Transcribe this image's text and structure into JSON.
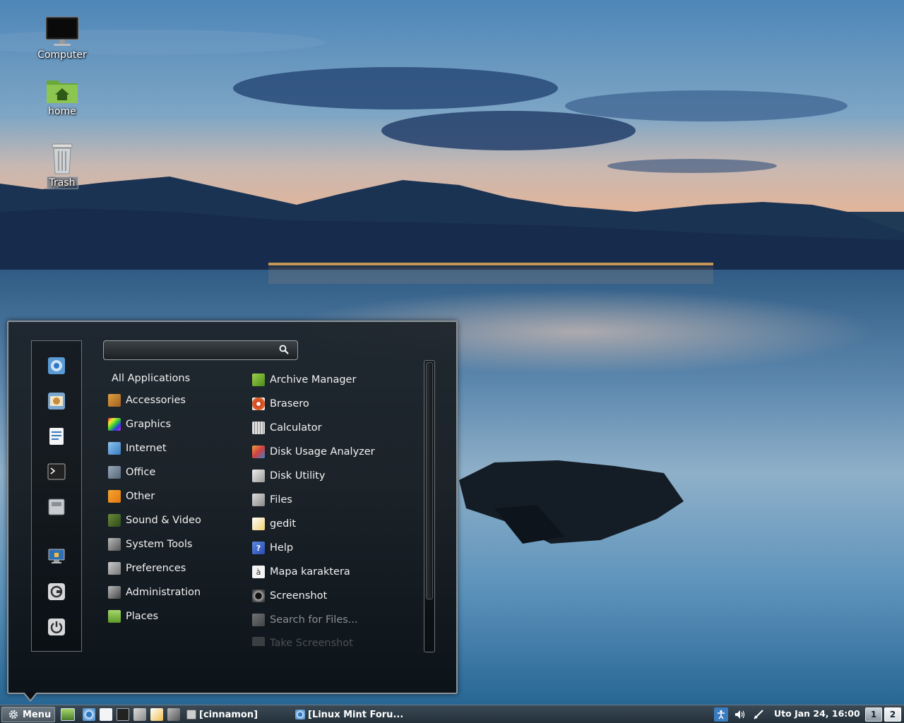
{
  "desktop": {
    "icons": [
      {
        "label": "Computer",
        "icon": "monitor-icon"
      },
      {
        "label": "home",
        "icon": "home-folder-icon"
      },
      {
        "label": "Trash",
        "icon": "trash-icon"
      }
    ]
  },
  "menu": {
    "search_value": "",
    "favorites": [
      "chromium-icon",
      "mail-client-icon",
      "text-editor-icon",
      "terminal-icon",
      "files-icon",
      "lock-screen-icon",
      "logout-icon",
      "shutdown-icon"
    ],
    "categories": [
      {
        "label": "All Applications",
        "icon": ""
      },
      {
        "label": "Accessories",
        "icon": "accessories-icon"
      },
      {
        "label": "Graphics",
        "icon": "graphics-icon"
      },
      {
        "label": "Internet",
        "icon": "internet-icon"
      },
      {
        "label": "Office",
        "icon": "office-icon"
      },
      {
        "label": "Other",
        "icon": "other-icon"
      },
      {
        "label": "Sound & Video",
        "icon": "sound-video-icon"
      },
      {
        "label": "System Tools",
        "icon": "system-tools-icon"
      },
      {
        "label": "Preferences",
        "icon": "preferences-icon"
      },
      {
        "label": "Administration",
        "icon": "administration-icon"
      },
      {
        "label": "Places",
        "icon": "places-folder-icon"
      }
    ],
    "apps": [
      {
        "label": "Archive Manager",
        "icon": "archive-manager-icon"
      },
      {
        "label": "Brasero",
        "icon": "brasero-icon"
      },
      {
        "label": "Calculator",
        "icon": "calculator-icon"
      },
      {
        "label": "Disk Usage Analyzer",
        "icon": "disk-usage-icon"
      },
      {
        "label": "Disk Utility",
        "icon": "disk-utility-icon"
      },
      {
        "label": "Files",
        "icon": "files-icon"
      },
      {
        "label": "gedit",
        "icon": "gedit-icon"
      },
      {
        "label": "Help",
        "icon": "help-icon",
        "glyph": "?"
      },
      {
        "label": "Mapa karaktera",
        "icon": "character-map-icon",
        "glyph": "à"
      },
      {
        "label": "Screenshot",
        "icon": "screenshot-icon"
      },
      {
        "label": "Search for Files...",
        "icon": "search-files-icon"
      },
      {
        "label": "Take Screenshot",
        "icon": "take-screenshot-icon"
      }
    ]
  },
  "panel": {
    "menu_label": "Menu",
    "launchers": [
      "show-desktop-icon",
      "chromium-icon",
      "text-editor-icon",
      "terminal-icon",
      "files-icon",
      "gedit-icon",
      "system-tools-icon"
    ],
    "windows": [
      {
        "label": "[cinnamon]",
        "icon": "terminal-window-icon"
      },
      {
        "label": "[Linux Mint Foru...",
        "icon": "chromium-window-icon"
      }
    ],
    "tray": [
      "accessibility-icon",
      "volume-icon",
      "network-icon"
    ],
    "clock": "Uto Jan 24, 16:00",
    "workspaces": [
      "1",
      "2"
    ],
    "active_workspace": "1"
  }
}
